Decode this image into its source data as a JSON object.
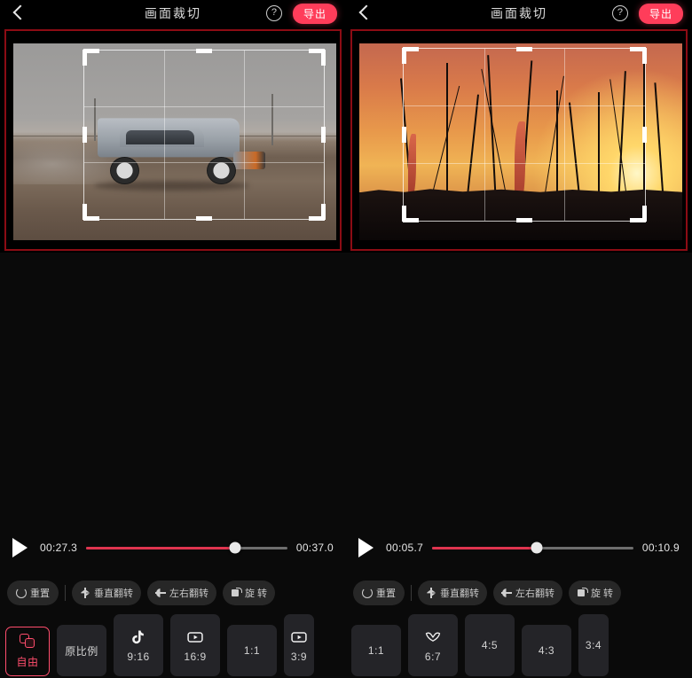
{
  "app": {
    "accent_pink": "#ff3d5a",
    "selected_pink": "#ff4d6d",
    "progress_red": "#e0344f",
    "panel_border_red": "#8c0c14"
  },
  "panels": [
    {
      "header": {
        "back_icon": "chevron-left-icon",
        "title": "画面裁切",
        "help_icon": "question-mark-icon",
        "help_glyph": "?",
        "export_label": "导出"
      },
      "preview": {
        "content": "car-drifting-on-dirt",
        "watermark": ""
      },
      "player": {
        "play_icon": "play-icon",
        "current_time": "00:27.3",
        "total_time": "00:37.0",
        "progress_percent": 74
      },
      "tools": [
        {
          "label": "重置",
          "icon": "reset-icon"
        },
        {
          "label": "垂直翻转",
          "icon": "flip-vertical-icon"
        },
        {
          "label": "左右翻转",
          "icon": "flip-horizontal-icon"
        },
        {
          "label": "旋 转",
          "icon": "rotate-icon"
        }
      ],
      "ratios": [
        {
          "label": "自由",
          "icon": "free-crop-icon",
          "selected": true,
          "clipped": false
        },
        {
          "label": "原比例",
          "icon": "",
          "selected": false,
          "clipped": false
        },
        {
          "label": "9:16",
          "icon": "tiktok-icon",
          "selected": false,
          "clipped": false
        },
        {
          "label": "16:9",
          "icon": "youtube-icon",
          "selected": false,
          "clipped": false
        },
        {
          "label": "1:1",
          "icon": "",
          "selected": false,
          "clipped": false
        },
        {
          "label": "3:9",
          "icon": "youtube-icon",
          "selected": false,
          "clipped": true
        }
      ]
    },
    {
      "header": {
        "back_icon": "chevron-left-icon",
        "title": "画面裁切",
        "help_icon": "question-mark-icon",
        "help_glyph": "?",
        "export_label": "导出"
      },
      "preview": {
        "content": "sailboat-masts-at-sunset",
        "watermark": ""
      },
      "player": {
        "play_icon": "play-icon",
        "current_time": "00:05.7",
        "total_time": "00:10.9",
        "progress_percent": 52
      },
      "tools": [
        {
          "label": "重置",
          "icon": "reset-icon"
        },
        {
          "label": "垂直翻转",
          "icon": "flip-vertical-icon"
        },
        {
          "label": "左右翻转",
          "icon": "flip-horizontal-icon"
        },
        {
          "label": "旋 转",
          "icon": "rotate-icon"
        }
      ],
      "ratios": [
        {
          "label": "1:1",
          "icon": "",
          "selected": false,
          "clipped": false
        },
        {
          "label": "6:7",
          "icon": "butterfly-icon",
          "selected": false,
          "clipped": false
        },
        {
          "label": "4:5",
          "icon": "",
          "selected": false,
          "clipped": false
        },
        {
          "label": "4:3",
          "icon": "",
          "selected": false,
          "clipped": false
        },
        {
          "label": "3:4",
          "icon": "",
          "selected": false,
          "clipped": true
        }
      ]
    }
  ]
}
